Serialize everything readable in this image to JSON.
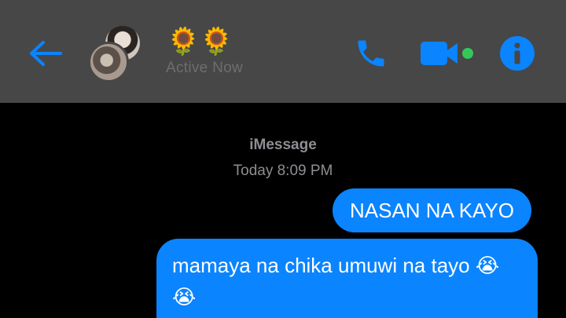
{
  "header": {
    "contact_name": "🌻🌻",
    "status": "Active Now"
  },
  "icons": {
    "back": "back-arrow-icon",
    "phone": "phone-icon",
    "video": "video-camera-icon",
    "info": "info-icon",
    "online_dot": "online-dot-icon"
  },
  "colors": {
    "accent": "#0a84ff",
    "online": "#34c759",
    "header_bg": "#474747"
  },
  "conversation": {
    "service": "iMessage",
    "timestamp": "Today 8:09 PM",
    "messages": [
      {
        "text": "NASAN NA KAYO"
      },
      {
        "text": "mamaya na chika umuwi na tayo 😭 😭"
      }
    ]
  }
}
